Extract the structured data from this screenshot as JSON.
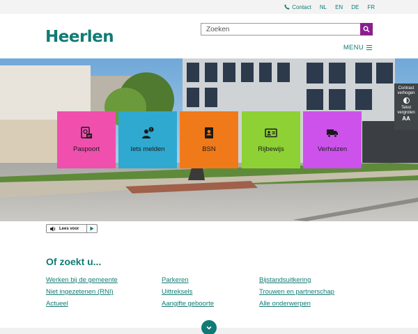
{
  "topbar": {
    "contact": "Contact",
    "languages": [
      "NL",
      "EN",
      "DE",
      "FR"
    ]
  },
  "header": {
    "logo": "Heerlen",
    "search_placeholder": "Zoeken",
    "menu_label": "MENU"
  },
  "tiles": [
    {
      "label": "Paspoort",
      "color": "#f04fae",
      "icon": "passport-icon"
    },
    {
      "label": "Iets melden",
      "color": "#2fa9cf",
      "icon": "report-person-icon"
    },
    {
      "label": "BSN",
      "color": "#f07a1a",
      "icon": "id-document-icon"
    },
    {
      "label": "Rijbewijs",
      "color": "#8ed134",
      "icon": "drivers-license-icon"
    },
    {
      "label": "Verhuizen",
      "color": "#cd52ec",
      "icon": "moving-truck-icon"
    }
  ],
  "sidetools": {
    "contrast": "Contrast verhogen",
    "textsize": "Tekst vergroten",
    "textsize_glyph": "AA"
  },
  "readaloud": {
    "label": "Lees voor"
  },
  "section": {
    "heading": "Of zoekt u...",
    "links": [
      [
        "Werken bij de gemeente",
        "Niet ingezetenen (RNI)",
        "Actueel"
      ],
      [
        "Parkeren",
        "Uittreksels",
        "Aangifte geboorte"
      ],
      [
        "Bijstandsuitkering",
        "Trouwen en partnerschap",
        "Alle onderwerpen"
      ]
    ]
  },
  "colors": {
    "brand": "#117a74",
    "search_button": "#8b1e8f"
  }
}
